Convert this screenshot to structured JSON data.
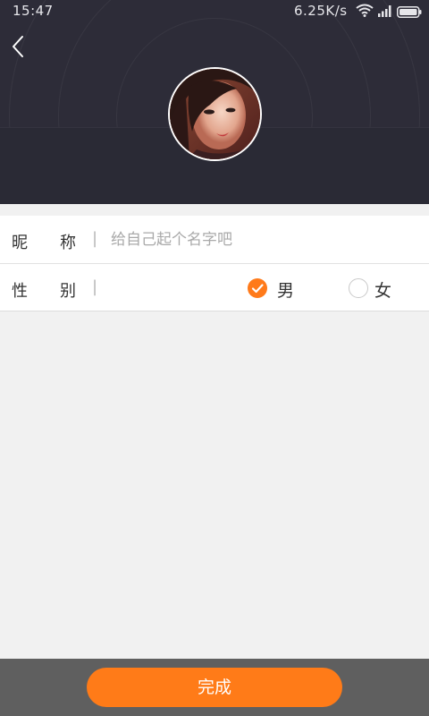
{
  "status_bar": {
    "time": "15:47",
    "network_speed": "6.25K/s",
    "icons": [
      "wifi-icon",
      "signal-icon",
      "battery-icon"
    ]
  },
  "header": {
    "back_icon": "chevron-left-icon",
    "avatar": "profile-photo"
  },
  "form": {
    "nickname": {
      "label_first": "昵",
      "label_second": "称",
      "separator": "|",
      "value": "",
      "placeholder": "给自己起个名字吧"
    },
    "gender": {
      "label_first": "性",
      "label_second": "别",
      "separator": "|",
      "options": [
        {
          "label": "男",
          "selected": true
        },
        {
          "label": "女",
          "selected": false
        }
      ]
    }
  },
  "footer": {
    "done_label": "完成"
  },
  "colors": {
    "accent": "#ff7b18",
    "header_bg": "#2d2c38",
    "page_bg": "#f1f1f1",
    "footer_bg": "#5f5f5f"
  }
}
